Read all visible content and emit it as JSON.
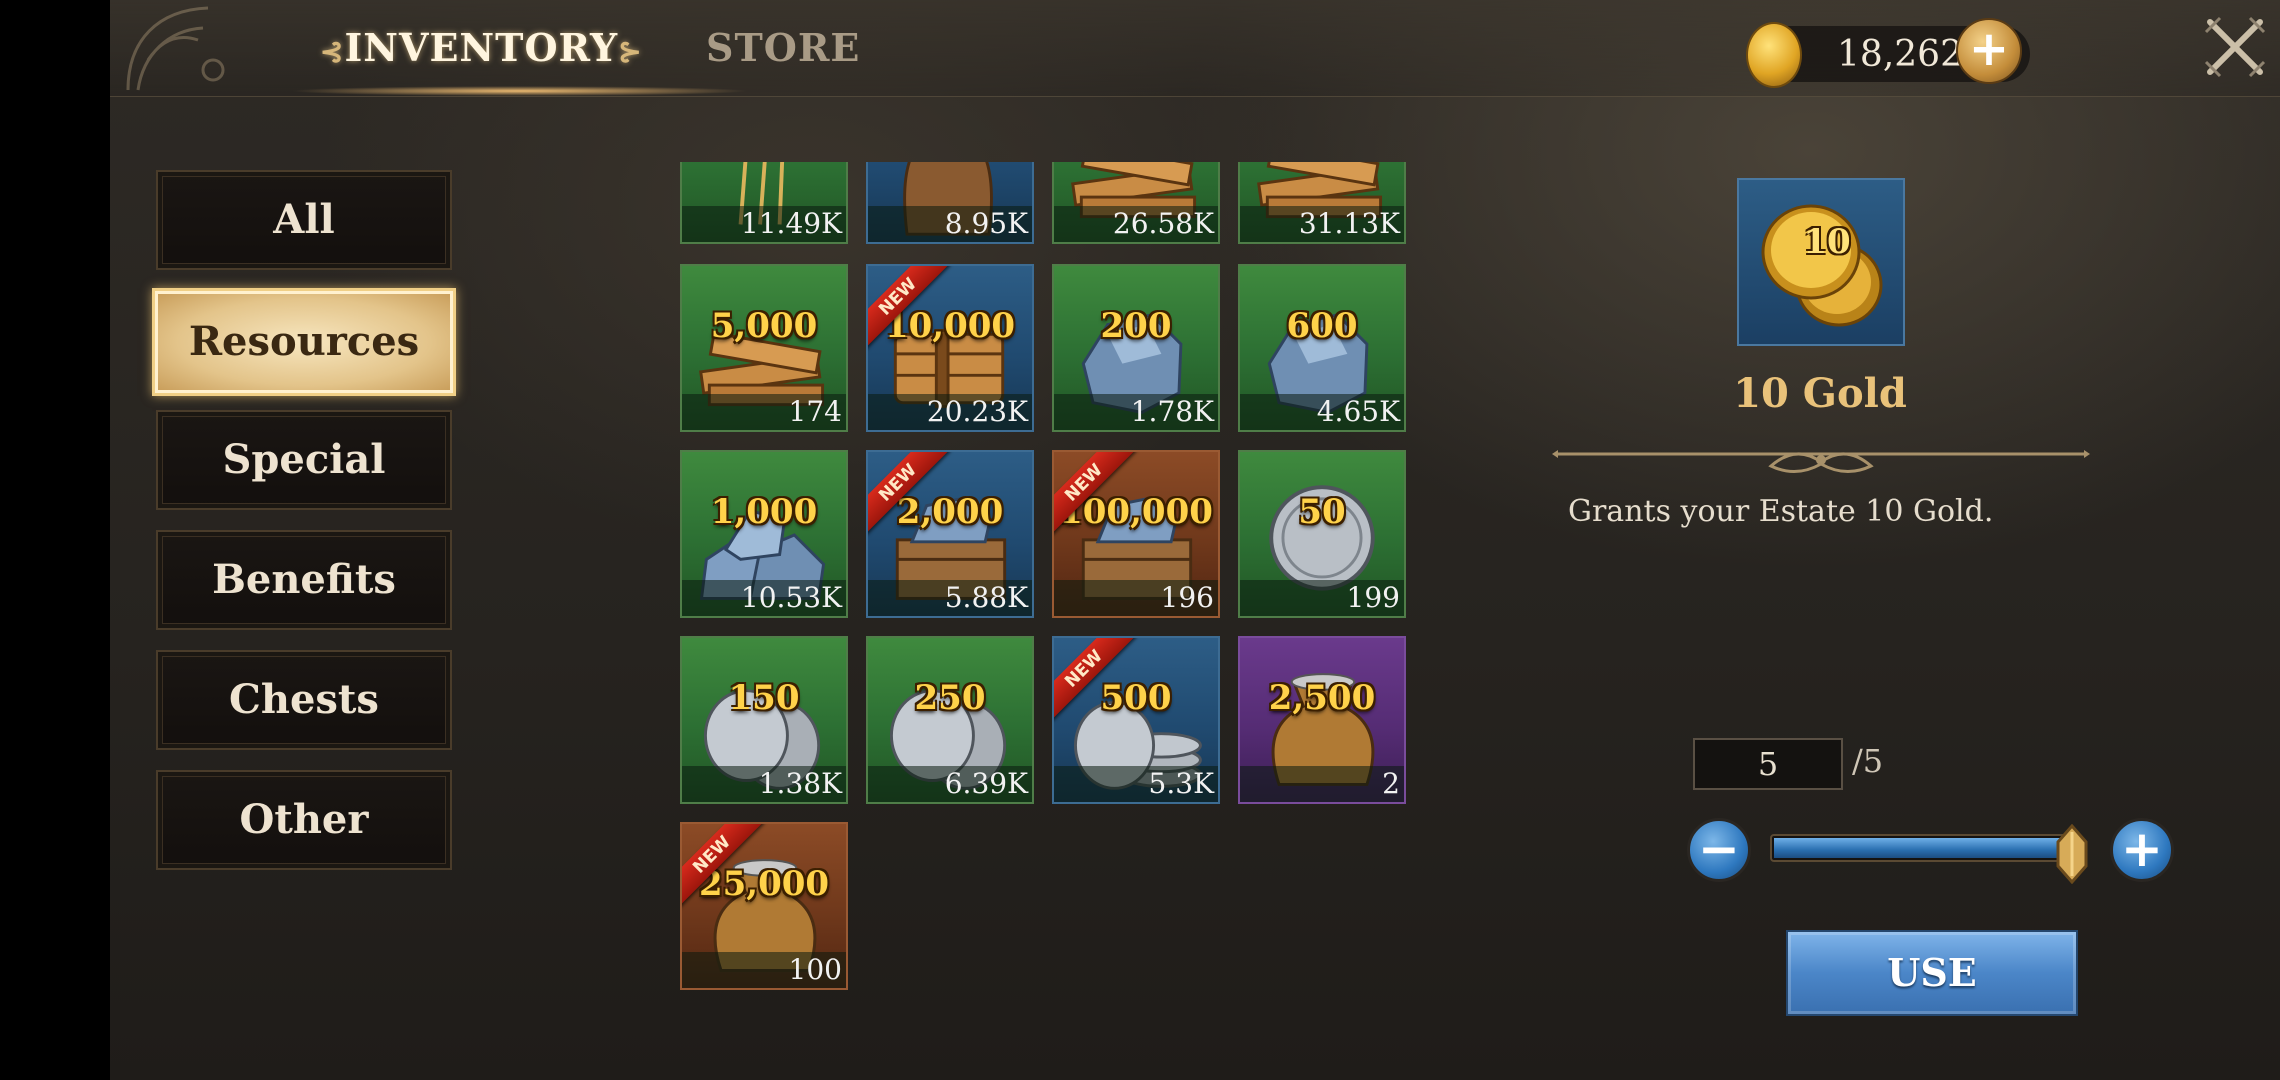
{
  "header": {
    "tabs": [
      {
        "label": "INVENTORY",
        "active": true
      },
      {
        "label": "STORE",
        "active": false
      }
    ],
    "gold": "18,262",
    "plus_icon": "plus-icon",
    "close_icon": "crossed-swords-close-icon"
  },
  "sidebar": {
    "items": [
      {
        "label": "All",
        "active": false
      },
      {
        "label": "Resources",
        "active": true
      },
      {
        "label": "Special",
        "active": false
      },
      {
        "label": "Benefits",
        "active": false
      },
      {
        "label": "Chests",
        "active": false
      },
      {
        "label": "Other",
        "active": false
      }
    ]
  },
  "grid": {
    "new_label": "NEW",
    "items": [
      {
        "icon": "wheat-icon",
        "bg": "green",
        "amount": "",
        "count": "11.49K",
        "new": false
      },
      {
        "icon": "sack-icon",
        "bg": "blue",
        "amount": "",
        "count": "8.95K",
        "new": false
      },
      {
        "icon": "wood-planks-icon",
        "bg": "green",
        "amount": "",
        "count": "26.58K",
        "new": false
      },
      {
        "icon": "wood-planks-icon",
        "bg": "green",
        "amount": "",
        "count": "31.13K",
        "new": false
      },
      {
        "icon": "wood-planks-icon",
        "bg": "green",
        "amount": "5,000",
        "count": "174",
        "new": false
      },
      {
        "icon": "wood-bundle-icon",
        "bg": "blue",
        "amount": "10,000",
        "count": "20.23K",
        "new": true
      },
      {
        "icon": "stone-icon",
        "bg": "green",
        "amount": "200",
        "count": "1.78K",
        "new": false
      },
      {
        "icon": "stone-icon",
        "bg": "green",
        "amount": "600",
        "count": "4.65K",
        "new": false
      },
      {
        "icon": "stone-pile-icon",
        "bg": "green",
        "amount": "1,000",
        "count": "10.53K",
        "new": false
      },
      {
        "icon": "stone-crate-icon",
        "bg": "blue",
        "amount": "2,000",
        "count": "5.88K",
        "new": true
      },
      {
        "icon": "stone-crate-icon",
        "bg": "orange",
        "amount": "100,000",
        "count": "196",
        "new": true
      },
      {
        "icon": "silver-coin-icon",
        "bg": "green",
        "amount": "50",
        "count": "199",
        "new": false
      },
      {
        "icon": "silver-coins-icon",
        "bg": "green",
        "amount": "150",
        "count": "1.38K",
        "new": false
      },
      {
        "icon": "silver-coins-icon",
        "bg": "green",
        "amount": "250",
        "count": "6.39K",
        "new": false
      },
      {
        "icon": "silver-stack-icon",
        "bg": "blue",
        "amount": "500",
        "count": "5.3K",
        "new": true
      },
      {
        "icon": "coin-bag-icon",
        "bg": "purple",
        "amount": "2,500",
        "count": "2",
        "new": false
      },
      {
        "icon": "coin-bag-icon",
        "bg": "orange",
        "amount": "25,000",
        "count": "100",
        "new": true
      }
    ]
  },
  "detail": {
    "icon": "gold-coins-icon",
    "icon_amount": "10",
    "title": "10 Gold",
    "description": "Grants your Estate 10 Gold.",
    "quantity": "5",
    "quantity_max": "/5",
    "slider_fraction": 1.0,
    "minus_icon": "minus-icon",
    "plus_icon": "plus-icon",
    "use_label": "USE"
  },
  "colors": {
    "accent_gold": "#e9c27a",
    "use_button": "#4b86c8",
    "tile_green": "#2c6f33",
    "tile_blue": "#204a70",
    "tile_orange": "#6f381b",
    "tile_purple": "#552c74"
  }
}
